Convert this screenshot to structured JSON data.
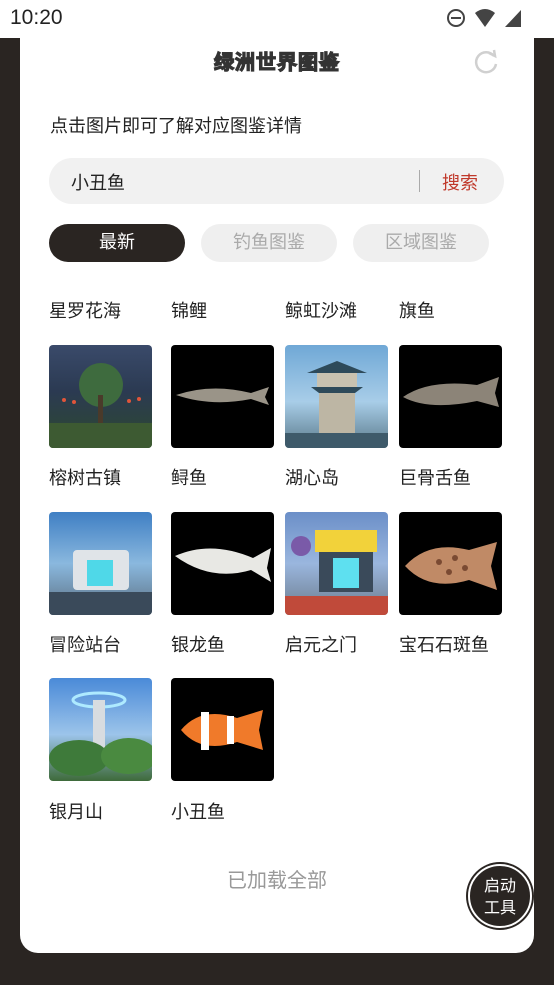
{
  "status": {
    "time": "10:20"
  },
  "header": {
    "title": "绿洲世界图鉴"
  },
  "hint": "点击图片即可了解对应图鉴详情",
  "search": {
    "value": "小丑鱼",
    "button": "搜索"
  },
  "tabs": [
    {
      "label": "最新",
      "active": true
    },
    {
      "label": "钓鱼图鉴",
      "active": false
    },
    {
      "label": "区域图鉴",
      "active": false
    }
  ],
  "top_labels": [
    "星罗花海",
    "锦鲤",
    "鲸虹沙滩",
    "旗鱼"
  ],
  "items": [
    {
      "label": "榕树古镇",
      "image": "night-town-scene"
    },
    {
      "label": "鲟鱼",
      "image": "sturgeon-fish"
    },
    {
      "label": "湖心岛",
      "image": "pagoda-tower-scene"
    },
    {
      "label": "巨骨舌鱼",
      "image": "arapaima-fish"
    },
    {
      "label": "冒险站台",
      "image": "adventure-platform-scene"
    },
    {
      "label": "银龙鱼",
      "image": "silver-arowana-fish"
    },
    {
      "label": "启元之门",
      "image": "gate-scene"
    },
    {
      "label": "宝石石斑鱼",
      "image": "grouper-fish"
    },
    {
      "label": "银月山",
      "image": "silver-moon-mountain-scene"
    },
    {
      "label": "小丑鱼",
      "image": "clownfish"
    }
  ],
  "footer": "已加载全部",
  "fab": {
    "line1": "启动",
    "line2": "工具"
  }
}
